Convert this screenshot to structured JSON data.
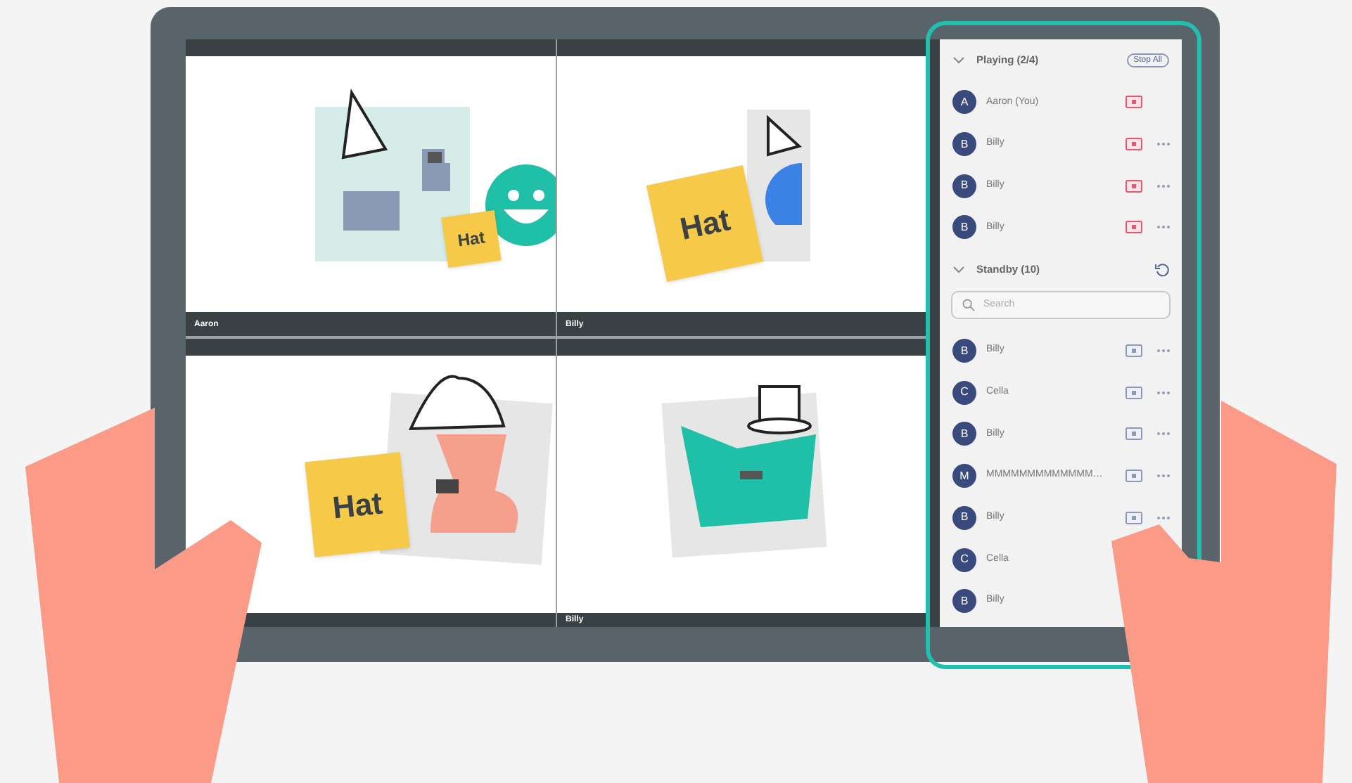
{
  "tiles": [
    {
      "name": "Aaron",
      "kind": "dog",
      "sticker": "Hat"
    },
    {
      "name": "Billy",
      "kind": "bird",
      "sticker": "Hat"
    },
    {
      "kind": "fox",
      "sticker": "Hat"
    },
    {
      "name": "Billy",
      "kind": "cat"
    }
  ],
  "sections": [
    {
      "kind": "playing",
      "title": "Playing (2/4)",
      "expanded": true,
      "button": "Stop All",
      "members": [
        {
          "initial": "A",
          "name": "Aaron (You)",
          "actions": false
        },
        {
          "initial": "B",
          "name": "Billy",
          "actions": true
        },
        {
          "initial": "B",
          "name": "Billy",
          "actions": true
        },
        {
          "initial": "B",
          "name": "Billy",
          "actions": true
        }
      ]
    },
    {
      "kind": "standby",
      "title": "Standby (10)",
      "expanded": true,
      "search": {
        "placeholder": "Search"
      },
      "members": [
        {
          "initial": "B",
          "name": "Billy",
          "actions": true
        },
        {
          "initial": "C",
          "name": "Cella",
          "actions": true
        },
        {
          "initial": "B",
          "name": "Billy",
          "actions": true
        },
        {
          "initial": "M",
          "name": "MMMMMMMMMMMMM…",
          "actions": true
        },
        {
          "initial": "B",
          "name": "Billy",
          "actions": true
        },
        {
          "initial": "C",
          "name": "Cella",
          "actions": false
        },
        {
          "initial": "B",
          "name": "Billy",
          "actions": false
        }
      ]
    }
  ]
}
